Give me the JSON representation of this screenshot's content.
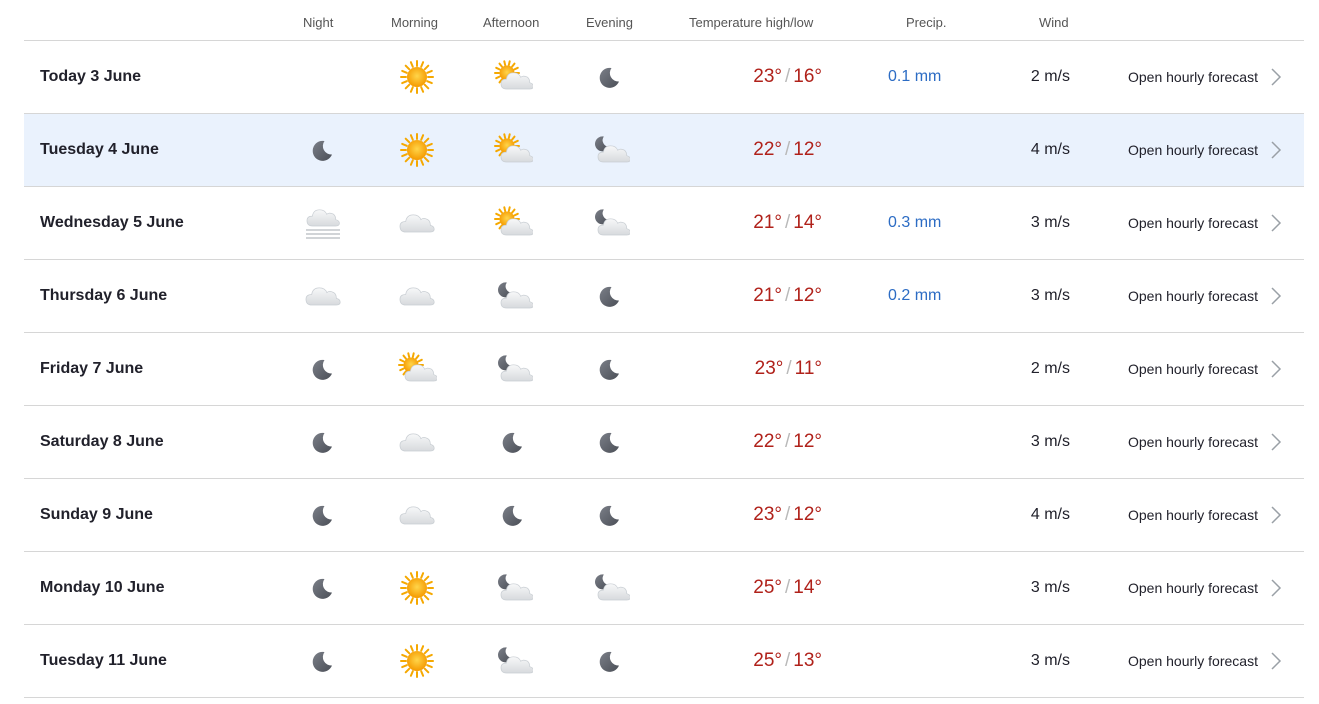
{
  "header": {
    "night": "Night",
    "morning": "Morning",
    "afternoon": "Afternoon",
    "evening": "Evening",
    "temperature": "Temperature high/low",
    "precip": "Precip.",
    "wind": "Wind"
  },
  "icon_names": {
    "sun": "sun-icon",
    "partly": "partly-cloudy-day-icon",
    "moon": "moon-icon",
    "moon_cloud": "partly-cloudy-night-icon",
    "cloud": "cloud-icon",
    "fog": "fog-icon"
  },
  "rows": [
    {
      "day": "Today 3 June",
      "night": "",
      "morning": "sun",
      "afternoon": "partly",
      "evening": "moon",
      "high": "23°",
      "low": "16°",
      "precip": "0.1 mm",
      "wind": "2 m/s",
      "link": "Open hourly forecast"
    },
    {
      "day": "Tuesday 4 June",
      "night": "moon",
      "morning": "sun",
      "afternoon": "partly",
      "evening": "moon_cloud",
      "high": "22°",
      "low": "12°",
      "precip": "",
      "wind": "4 m/s",
      "link": "Open hourly forecast",
      "selected": true
    },
    {
      "day": "Wednesday 5 June",
      "night": "fog",
      "morning": "cloud",
      "afternoon": "partly",
      "evening": "moon_cloud",
      "high": "21°",
      "low": "14°",
      "precip": "0.3 mm",
      "wind": "3 m/s",
      "link": "Open hourly forecast"
    },
    {
      "day": "Thursday 6 June",
      "night": "cloud",
      "morning": "cloud",
      "afternoon": "moon_cloud",
      "evening": "moon",
      "high": "21°",
      "low": "12°",
      "precip": "0.2 mm",
      "wind": "3 m/s",
      "link": "Open hourly forecast"
    },
    {
      "day": "Friday 7 June",
      "night": "moon",
      "morning": "partly",
      "afternoon": "moon_cloud",
      "evening": "moon",
      "high": "23°",
      "low": "11°",
      "precip": "",
      "wind": "2 m/s",
      "link": "Open hourly forecast"
    },
    {
      "day": "Saturday 8 June",
      "night": "moon",
      "morning": "cloud",
      "afternoon": "moon",
      "evening": "moon",
      "high": "22°",
      "low": "12°",
      "precip": "",
      "wind": "3 m/s",
      "link": "Open hourly forecast"
    },
    {
      "day": "Sunday 9 June",
      "night": "moon",
      "morning": "cloud",
      "afternoon": "moon",
      "evening": "moon",
      "high": "23°",
      "low": "12°",
      "precip": "",
      "wind": "4 m/s",
      "link": "Open hourly forecast"
    },
    {
      "day": "Monday 10 June",
      "night": "moon",
      "morning": "sun",
      "afternoon": "moon_cloud",
      "evening": "moon_cloud",
      "high": "25°",
      "low": "14°",
      "precip": "",
      "wind": "3 m/s",
      "link": "Open hourly forecast"
    },
    {
      "day": "Tuesday 11 June",
      "night": "moon",
      "morning": "sun",
      "afternoon": "moon_cloud",
      "evening": "moon",
      "high": "25°",
      "low": "13°",
      "precip": "",
      "wind": "3 m/s",
      "link": "Open hourly forecast"
    }
  ],
  "colors": {
    "temperature": "#b0211a",
    "precipitation": "#2c6cc4",
    "selected_row": "#eaf2fd",
    "divider": "#d6d6d6"
  }
}
